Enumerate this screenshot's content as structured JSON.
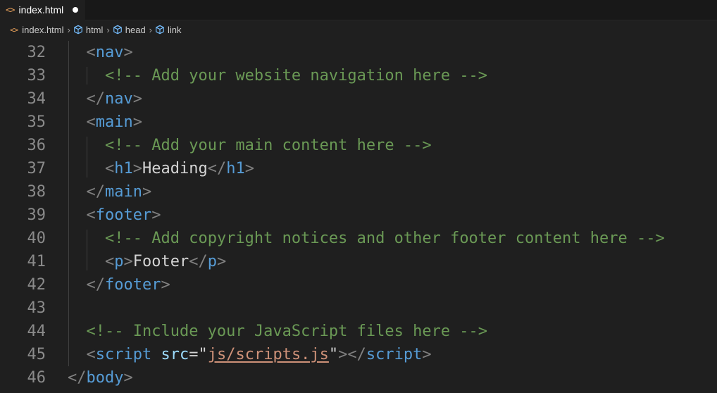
{
  "tab": {
    "filename": "index.html",
    "icon": "html-file-icon",
    "modified": true
  },
  "breadcrumb": {
    "items": [
      "index.html",
      "html",
      "head",
      "link"
    ]
  },
  "lines": [
    {
      "num": "32",
      "indent": 1,
      "tokens": [
        [
          "punc",
          "<"
        ],
        [
          "tag",
          "nav"
        ],
        [
          "punc",
          ">"
        ]
      ]
    },
    {
      "num": "33",
      "indent": 2,
      "tokens": [
        [
          "comment",
          "<!-- Add your website navigation here -->"
        ]
      ]
    },
    {
      "num": "34",
      "indent": 1,
      "tokens": [
        [
          "punc",
          "</"
        ],
        [
          "tag",
          "nav"
        ],
        [
          "punc",
          ">"
        ]
      ]
    },
    {
      "num": "35",
      "indent": 1,
      "tokens": [
        [
          "punc",
          "<"
        ],
        [
          "tag",
          "main"
        ],
        [
          "punc",
          ">"
        ]
      ]
    },
    {
      "num": "36",
      "indent": 2,
      "tokens": [
        [
          "comment",
          "<!-- Add your main content here -->"
        ]
      ]
    },
    {
      "num": "37",
      "indent": 2,
      "tokens": [
        [
          "punc",
          "<"
        ],
        [
          "tag",
          "h1"
        ],
        [
          "punc",
          ">"
        ],
        [
          "text",
          "Heading"
        ],
        [
          "punc",
          "</"
        ],
        [
          "tag",
          "h1"
        ],
        [
          "punc",
          ">"
        ]
      ]
    },
    {
      "num": "38",
      "indent": 1,
      "tokens": [
        [
          "punc",
          "</"
        ],
        [
          "tag",
          "main"
        ],
        [
          "punc",
          ">"
        ]
      ]
    },
    {
      "num": "39",
      "indent": 1,
      "tokens": [
        [
          "punc",
          "<"
        ],
        [
          "tag",
          "footer"
        ],
        [
          "punc",
          ">"
        ]
      ]
    },
    {
      "num": "40",
      "indent": 2,
      "tokens": [
        [
          "comment",
          "<!-- Add copyright notices and other footer content here -->"
        ]
      ]
    },
    {
      "num": "41",
      "indent": 2,
      "tokens": [
        [
          "punc",
          "<"
        ],
        [
          "tag",
          "p"
        ],
        [
          "punc",
          ">"
        ],
        [
          "text",
          "Footer"
        ],
        [
          "punc",
          "</"
        ],
        [
          "tag",
          "p"
        ],
        [
          "punc",
          ">"
        ]
      ]
    },
    {
      "num": "42",
      "indent": 1,
      "tokens": [
        [
          "punc",
          "</"
        ],
        [
          "tag",
          "footer"
        ],
        [
          "punc",
          ">"
        ]
      ]
    },
    {
      "num": "43",
      "indent": 1,
      "tokens": []
    },
    {
      "num": "44",
      "indent": 1,
      "tokens": [
        [
          "comment",
          "<!-- Include your JavaScript files here -->"
        ]
      ]
    },
    {
      "num": "45",
      "indent": 1,
      "tokens": [
        [
          "punc",
          "<"
        ],
        [
          "tag",
          "script"
        ],
        [
          "text",
          " "
        ],
        [
          "attr",
          "src"
        ],
        [
          "eq",
          "="
        ],
        [
          "eq",
          "\""
        ],
        [
          "str",
          "js/scripts.js"
        ],
        [
          "eq",
          "\""
        ],
        [
          "punc",
          ">"
        ],
        [
          "punc",
          "</"
        ],
        [
          "tag",
          "script"
        ],
        [
          "punc",
          ">"
        ]
      ]
    },
    {
      "num": "46",
      "indent": 0,
      "tokens": [
        [
          "punc",
          "</"
        ],
        [
          "tag",
          "body"
        ],
        [
          "punc",
          ">"
        ]
      ]
    }
  ],
  "colors": {
    "background": "#1f1f1f",
    "tag": "#569cd6",
    "comment": "#6a9955",
    "string": "#ce9178",
    "attribute": "#9cdcfe",
    "line_number": "#8a8a8a"
  }
}
